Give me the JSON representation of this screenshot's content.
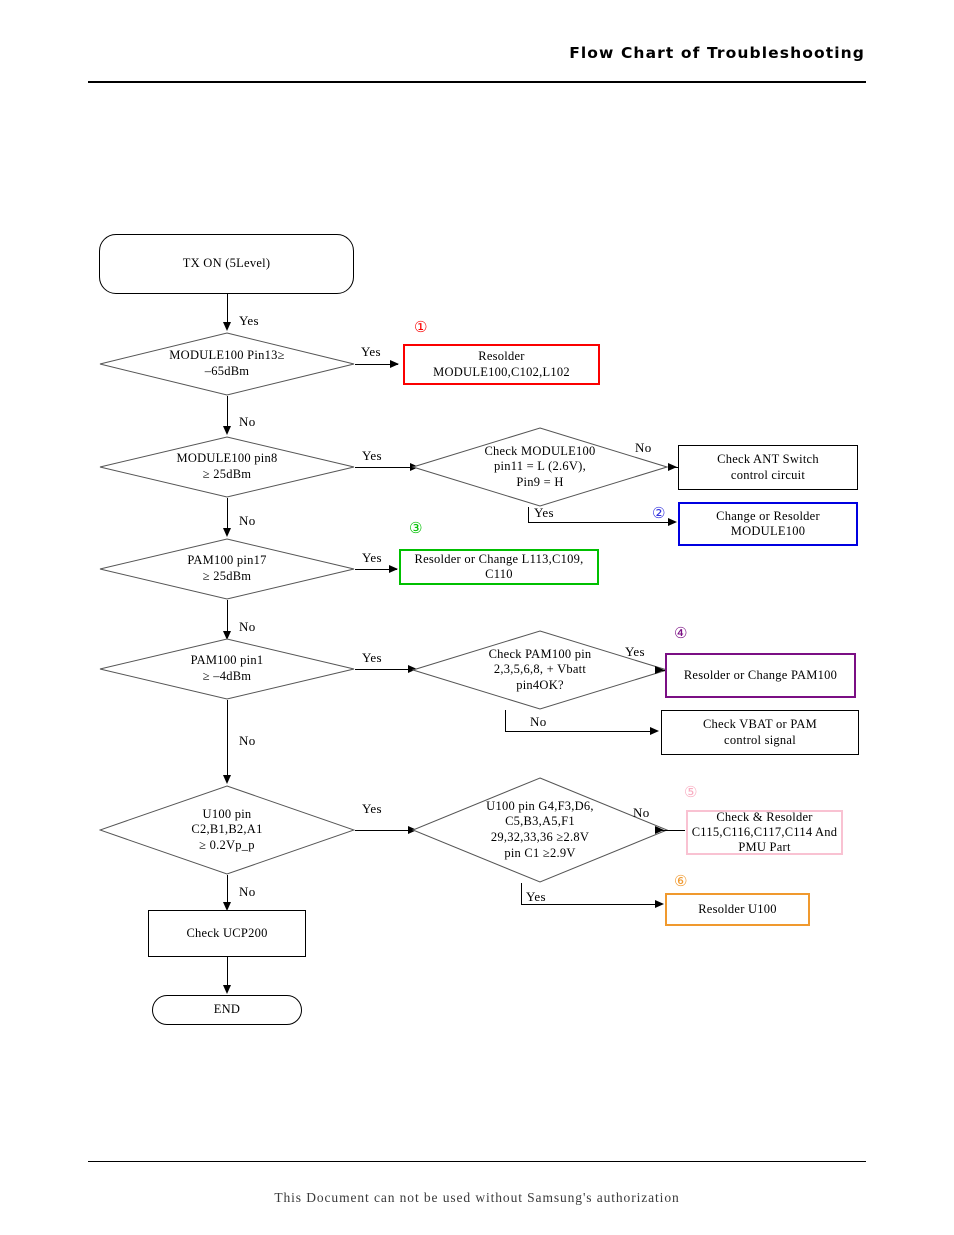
{
  "header": {
    "title": "Flow Chart of Troubleshooting"
  },
  "footer": {
    "text": "This Document can not be used without Samsung's authorization"
  },
  "chart_data": {
    "type": "diagram",
    "title": "Flow Chart of Troubleshooting",
    "nodes": [
      {
        "id": "start",
        "shape": "terminal",
        "text": "TX ON (5Level)",
        "color": "#000000"
      },
      {
        "id": "d1",
        "shape": "decision",
        "text": "MODULE100 Pin13≥ / ‒65dBm",
        "color": "#000000"
      },
      {
        "id": "a1",
        "shape": "process",
        "text": "Resolder MODULE100,C102,L102",
        "color": "#fb0000",
        "marker": "①"
      },
      {
        "id": "d2",
        "shape": "decision",
        "text": "MODULE100 pin8 ≥ 25dBm",
        "color": "#000000"
      },
      {
        "id": "d2b",
        "shape": "decision",
        "text": "Check MODULE100 pin11 = L (2.6V), Pin9 = H",
        "color": "#000000"
      },
      {
        "id": "a2a",
        "shape": "process",
        "text": "Check ANT Switch control circuit",
        "color": "#000000"
      },
      {
        "id": "a2b",
        "shape": "process",
        "text": "Change or Resolder MODULE100",
        "color": "#0000e0",
        "marker": "②"
      },
      {
        "id": "d3",
        "shape": "decision",
        "text": "PAM100 pin17 ≥ 25dBm",
        "color": "#000000"
      },
      {
        "id": "a3",
        "shape": "process",
        "text": "Resolder or Change L113,C109, C110",
        "color": "#00c000",
        "marker": "③"
      },
      {
        "id": "d4",
        "shape": "decision",
        "text": "PAM100 pin1 ≥ ‒4dBm",
        "color": "#000000"
      },
      {
        "id": "d4b",
        "shape": "decision",
        "text": "Check PAM100 pin 2,3,5,6,8, + Vbatt pin4OK?",
        "color": "#000000"
      },
      {
        "id": "a4a",
        "shape": "process",
        "text": "Resolder or Change PAM100",
        "color": "#7b0f84",
        "marker": "④"
      },
      {
        "id": "a4b",
        "shape": "process",
        "text": "Check VBAT or PAM control signal",
        "color": "#000000"
      },
      {
        "id": "d5",
        "shape": "decision",
        "text": "U100 pin C2,B1,B2,A1 ≥ 0.2Vp_p",
        "color": "#000000"
      },
      {
        "id": "d5b",
        "shape": "decision",
        "text": "U100 pin G4,F3,D6, C5,B3,A5,F1 29,32,33,36 ≥2.8V pin C1 ≥2.9V",
        "color": "#000000"
      },
      {
        "id": "a5a",
        "shape": "process",
        "text": "Check & Resolder C115,C116,C117,C114 And PMU Part",
        "color": "#f9c2d2",
        "marker": "⑤"
      },
      {
        "id": "a5b",
        "shape": "process",
        "text": "Resolder U100",
        "color": "#f0992e",
        "marker": "⑥"
      },
      {
        "id": "ucp",
        "shape": "process",
        "text": "Check UCP200",
        "color": "#000000"
      },
      {
        "id": "end",
        "shape": "terminal",
        "text": "END",
        "color": "#000000"
      }
    ],
    "edges": [
      {
        "from": "start",
        "to": "d1",
        "label": "Yes"
      },
      {
        "from": "d1",
        "to": "a1",
        "label": "Yes"
      },
      {
        "from": "d1",
        "to": "d2",
        "label": "No"
      },
      {
        "from": "d2",
        "to": "d2b",
        "label": "Yes"
      },
      {
        "from": "d2b",
        "to": "a2a",
        "label": "No"
      },
      {
        "from": "d2b",
        "to": "a2b",
        "label": "Yes"
      },
      {
        "from": "d2",
        "to": "d3",
        "label": "No"
      },
      {
        "from": "d3",
        "to": "a3",
        "label": "Yes"
      },
      {
        "from": "d3",
        "to": "d4",
        "label": "No"
      },
      {
        "from": "d4",
        "to": "d4b",
        "label": "Yes"
      },
      {
        "from": "d4b",
        "to": "a4a",
        "label": "Yes"
      },
      {
        "from": "d4b",
        "to": "a4b",
        "label": "No"
      },
      {
        "from": "d4",
        "to": "d5",
        "label": "No"
      },
      {
        "from": "d5",
        "to": "d5b",
        "label": "Yes"
      },
      {
        "from": "d5b",
        "to": "a5a",
        "label": "No"
      },
      {
        "from": "d5b",
        "to": "a5b",
        "label": "Yes"
      },
      {
        "from": "d5",
        "to": "ucp",
        "label": "No"
      },
      {
        "from": "ucp",
        "to": "end",
        "label": ""
      }
    ]
  },
  "nodes": {
    "start": {
      "text": "TX ON (5Level)"
    },
    "d1": {
      "line1": "MODULE100 Pin13≥",
      "line2": "‒65dBm"
    },
    "a1": {
      "line1": "Resolder",
      "line2": "MODULE100,C102,L102",
      "marker": "①"
    },
    "d2": {
      "line1": "MODULE100 pin8",
      "line2": "≥ 25dBm"
    },
    "d2b": {
      "line1": "Check MODULE100",
      "line2": "pin11 = L (2.6V),",
      "line3": "Pin9 = H"
    },
    "a2a": {
      "line1": "Check ANT Switch",
      "line2": "control circuit"
    },
    "a2b": {
      "line1": "Change or Resolder",
      "line2": "MODULE100",
      "marker": "②"
    },
    "d3": {
      "line1": "PAM100 pin17",
      "line2": "≥ 25dBm"
    },
    "a3": {
      "line1": "Resolder or Change L113,C109,",
      "line2": "C110",
      "marker": "③"
    },
    "d4": {
      "line1": "PAM100 pin1",
      "line2": "≥ ‒4dBm"
    },
    "d4b": {
      "line1": "Check PAM100 pin",
      "line2": "2,3,5,6,8, + Vbatt",
      "line3": "pin4OK?"
    },
    "a4a": {
      "line1": "Resolder or Change PAM100",
      "marker": "④"
    },
    "a4b": {
      "line1": "Check VBAT or PAM",
      "line2": "control signal"
    },
    "d5": {
      "line1": "U100 pin",
      "line2": "C2,B1,B2,A1",
      "line3": "≥ 0.2Vp_p"
    },
    "d5b": {
      "line1": "U100 pin G4,F3,D6,",
      "line2": "C5,B3,A5,F1",
      "line3": "29,32,33,36 ≥2.8V",
      "line4": "pin C1 ≥2.9V"
    },
    "a5a": {
      "line1": "Check & Resolder",
      "line2": "C115,C116,C117,C114 And",
      "line3": "PMU Part",
      "marker": "⑤"
    },
    "a5b": {
      "line1": "Resolder U100",
      "marker": "⑥"
    },
    "ucp": {
      "text": "Check UCP200"
    },
    "end": {
      "text": "END"
    }
  },
  "labels": {
    "yes": "Yes",
    "no": "No"
  }
}
